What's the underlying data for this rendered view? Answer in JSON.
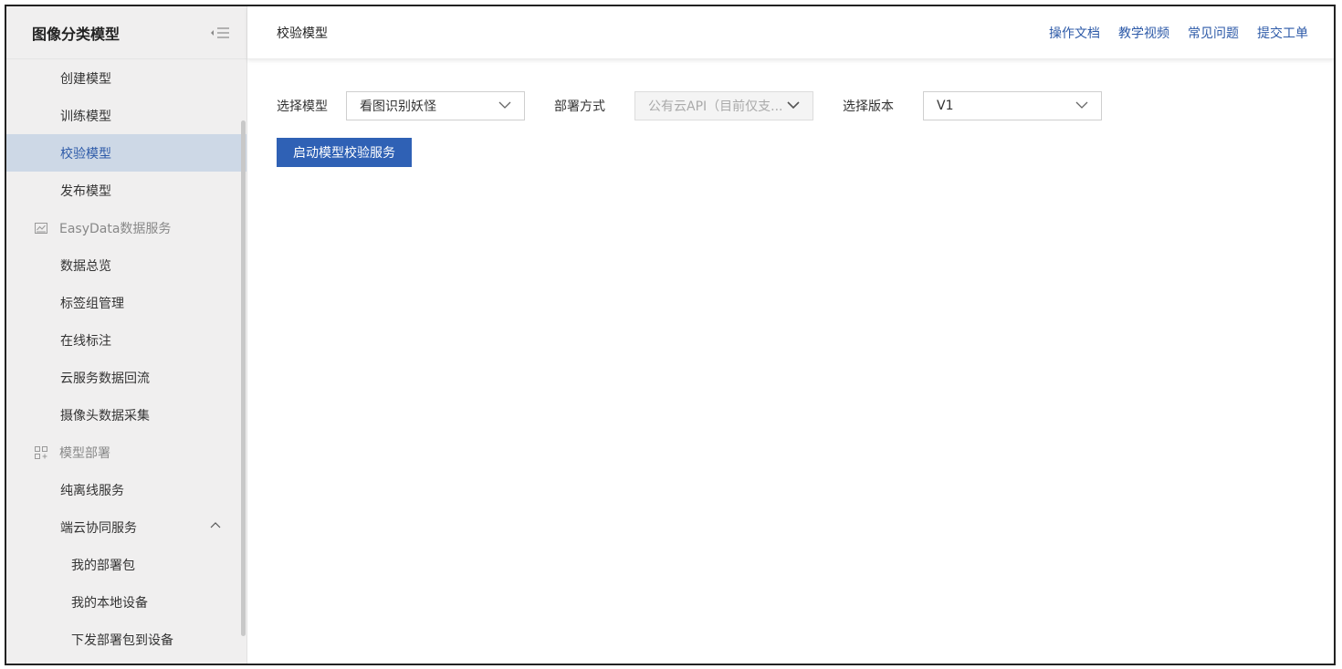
{
  "sidebar": {
    "title": "图像分类模型",
    "items": [
      {
        "label": "创建模型",
        "kind": "item"
      },
      {
        "label": "训练模型",
        "kind": "item"
      },
      {
        "label": "校验模型",
        "kind": "item",
        "active": true
      },
      {
        "label": "发布模型",
        "kind": "item"
      },
      {
        "label": "EasyData数据服务",
        "kind": "group",
        "icon": "chart-icon"
      },
      {
        "label": "数据总览",
        "kind": "item"
      },
      {
        "label": "标签组管理",
        "kind": "item"
      },
      {
        "label": "在线标注",
        "kind": "item"
      },
      {
        "label": "云服务数据回流",
        "kind": "item"
      },
      {
        "label": "摄像头数据采集",
        "kind": "item"
      },
      {
        "label": "模型部署",
        "kind": "group",
        "icon": "deploy-icon"
      },
      {
        "label": "纯离线服务",
        "kind": "item"
      },
      {
        "label": "端云协同服务",
        "kind": "item",
        "expanded": true
      },
      {
        "label": "我的部署包",
        "kind": "sub"
      },
      {
        "label": "我的本地设备",
        "kind": "sub"
      },
      {
        "label": "下发部署包到设备",
        "kind": "sub"
      }
    ]
  },
  "header": {
    "title": "校验模型",
    "links": [
      "操作文档",
      "教学视频",
      "常见问题",
      "提交工单"
    ]
  },
  "form": {
    "model_label": "选择模型",
    "model_value": "看图识别妖怪",
    "deploy_label": "部署方式",
    "deploy_value": "公有云API（目前仅支...",
    "version_label": "选择版本",
    "version_value": "V1",
    "start_button": "启动模型校验服务"
  },
  "colors": {
    "accent": "#2f61b5",
    "active_bg": "#cdd8e6",
    "sidebar_bg": "#f0efef"
  }
}
